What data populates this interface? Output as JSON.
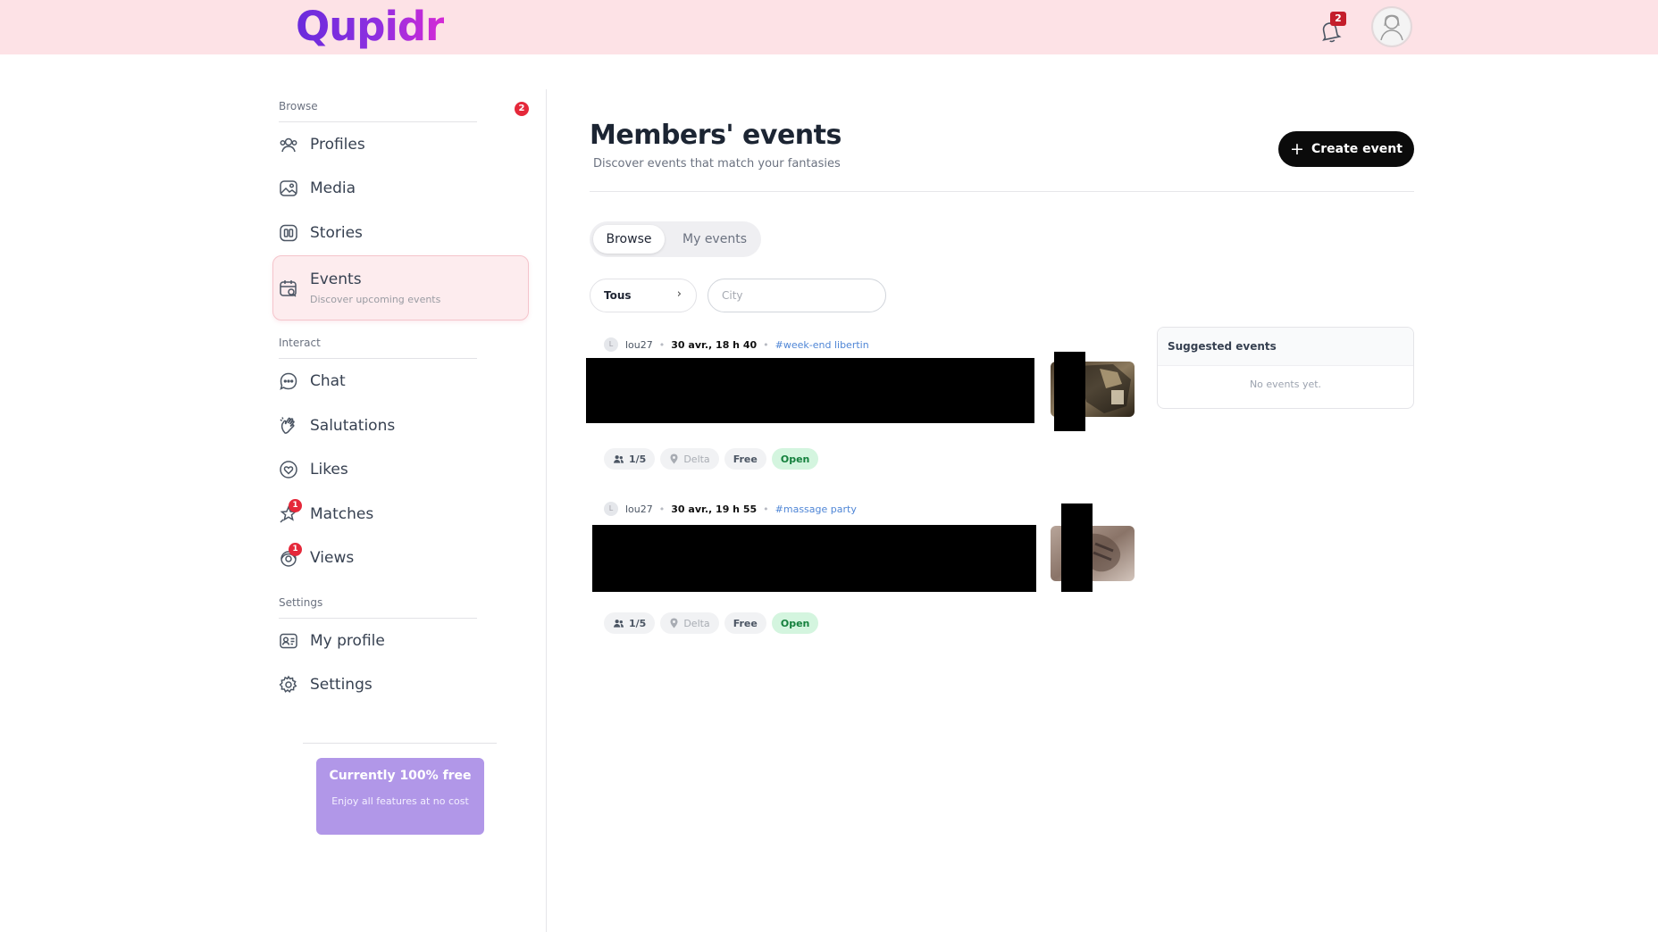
{
  "header": {
    "logo": "Qupidr",
    "notification_count": "2"
  },
  "sidebar": {
    "browse_label": "Browse",
    "browse_badge": "2",
    "interact_label": "Interact",
    "settings_label": "Settings",
    "items": {
      "profiles": "Profiles",
      "media": "Media",
      "stories": "Stories",
      "events": "Events",
      "events_sub": "Discover upcoming events",
      "chat": "Chat",
      "salutations": "Salutations",
      "likes": "Likes",
      "matches": "Matches",
      "matches_badge": "1",
      "views": "Views",
      "views_badge": "1",
      "my_profile": "My profile",
      "settings": "Settings"
    },
    "promo": {
      "title": "Currently 100% free",
      "subtitle": "Enjoy all features at no cost"
    }
  },
  "main": {
    "title": "Members' events",
    "subtitle": "Discover events that match your fantasies",
    "create_button": "Create event",
    "tabs": [
      "Browse",
      "My events"
    ],
    "filter_select": "Tous",
    "city_placeholder": "City",
    "events": [
      {
        "avatar_initial": "L",
        "user": "lou27",
        "date": "30 avr., 18 h 40",
        "tag": "#week-end libertin",
        "participants": "1/5",
        "location": "Delta",
        "price": "Free",
        "status": "Open"
      },
      {
        "avatar_initial": "L",
        "user": "lou27",
        "date": "30 avr., 19 h 55",
        "tag": "#massage party",
        "participants": "1/5",
        "location": "Delta",
        "price": "Free",
        "status": "Open"
      }
    ]
  },
  "suggested": {
    "title": "Suggested events",
    "empty": "No events yet."
  },
  "colors": {
    "header_bg": "#fde2e6",
    "logo_start": "#6a2bdc",
    "logo_end": "#d42ad6",
    "active_nav_bg": "#fdecee",
    "badge_red": "#e5283a",
    "promo_bg": "#b197e8",
    "open_chip_bg": "#d4f5df",
    "tag_blue": "#4f86d6"
  },
  "icons": [
    "bell-icon",
    "avatar-icon",
    "profiles-icon",
    "media-icon",
    "stories-icon",
    "events-icon",
    "chat-icon",
    "salutations-icon",
    "likes-icon",
    "matches-icon",
    "views-icon",
    "my-profile-icon",
    "settings-icon",
    "plus-icon",
    "chevron-right-icon",
    "people-icon",
    "location-pin-icon"
  ]
}
